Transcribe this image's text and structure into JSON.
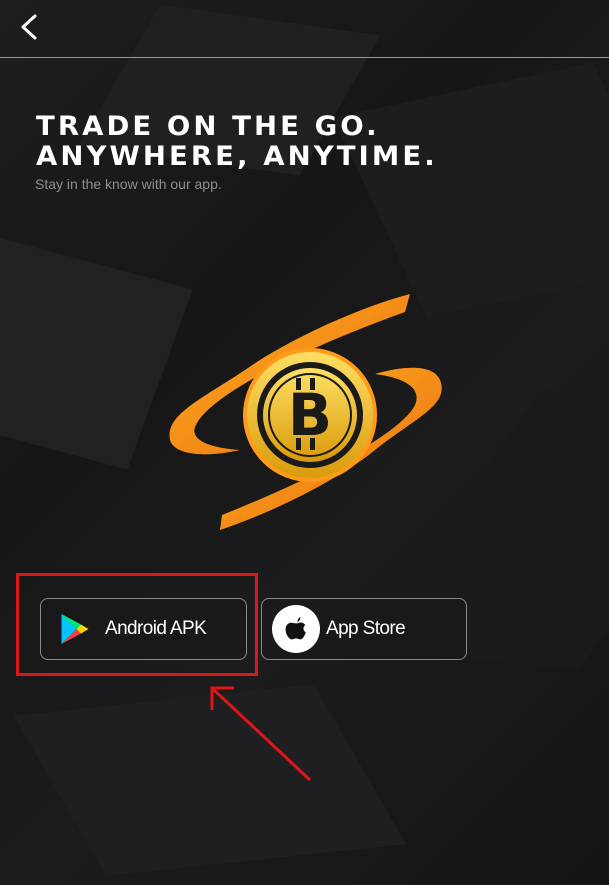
{
  "header": {
    "back_icon": "chevron-left-icon"
  },
  "hero": {
    "title_line1": "TRADE ON THE GO.",
    "title_line2": "ANYWHERE, ANYTIME.",
    "subtitle": "Stay in the know with our app."
  },
  "logo": {
    "icon": "bitcoin-swoosh-logo",
    "symbol": "B"
  },
  "downloads": {
    "android": {
      "label": "Android APK",
      "icon": "google-play-icon"
    },
    "apple": {
      "label": "App Store",
      "icon": "apple-icon"
    }
  },
  "annotation": {
    "highlight_color": "#e01515",
    "arrow_color": "#e01515"
  },
  "colors": {
    "background": "#1b1b1c",
    "accent_gold": "#b89a3a",
    "logo_orange": "#f08a1c",
    "logo_gold": "#f5c518"
  }
}
